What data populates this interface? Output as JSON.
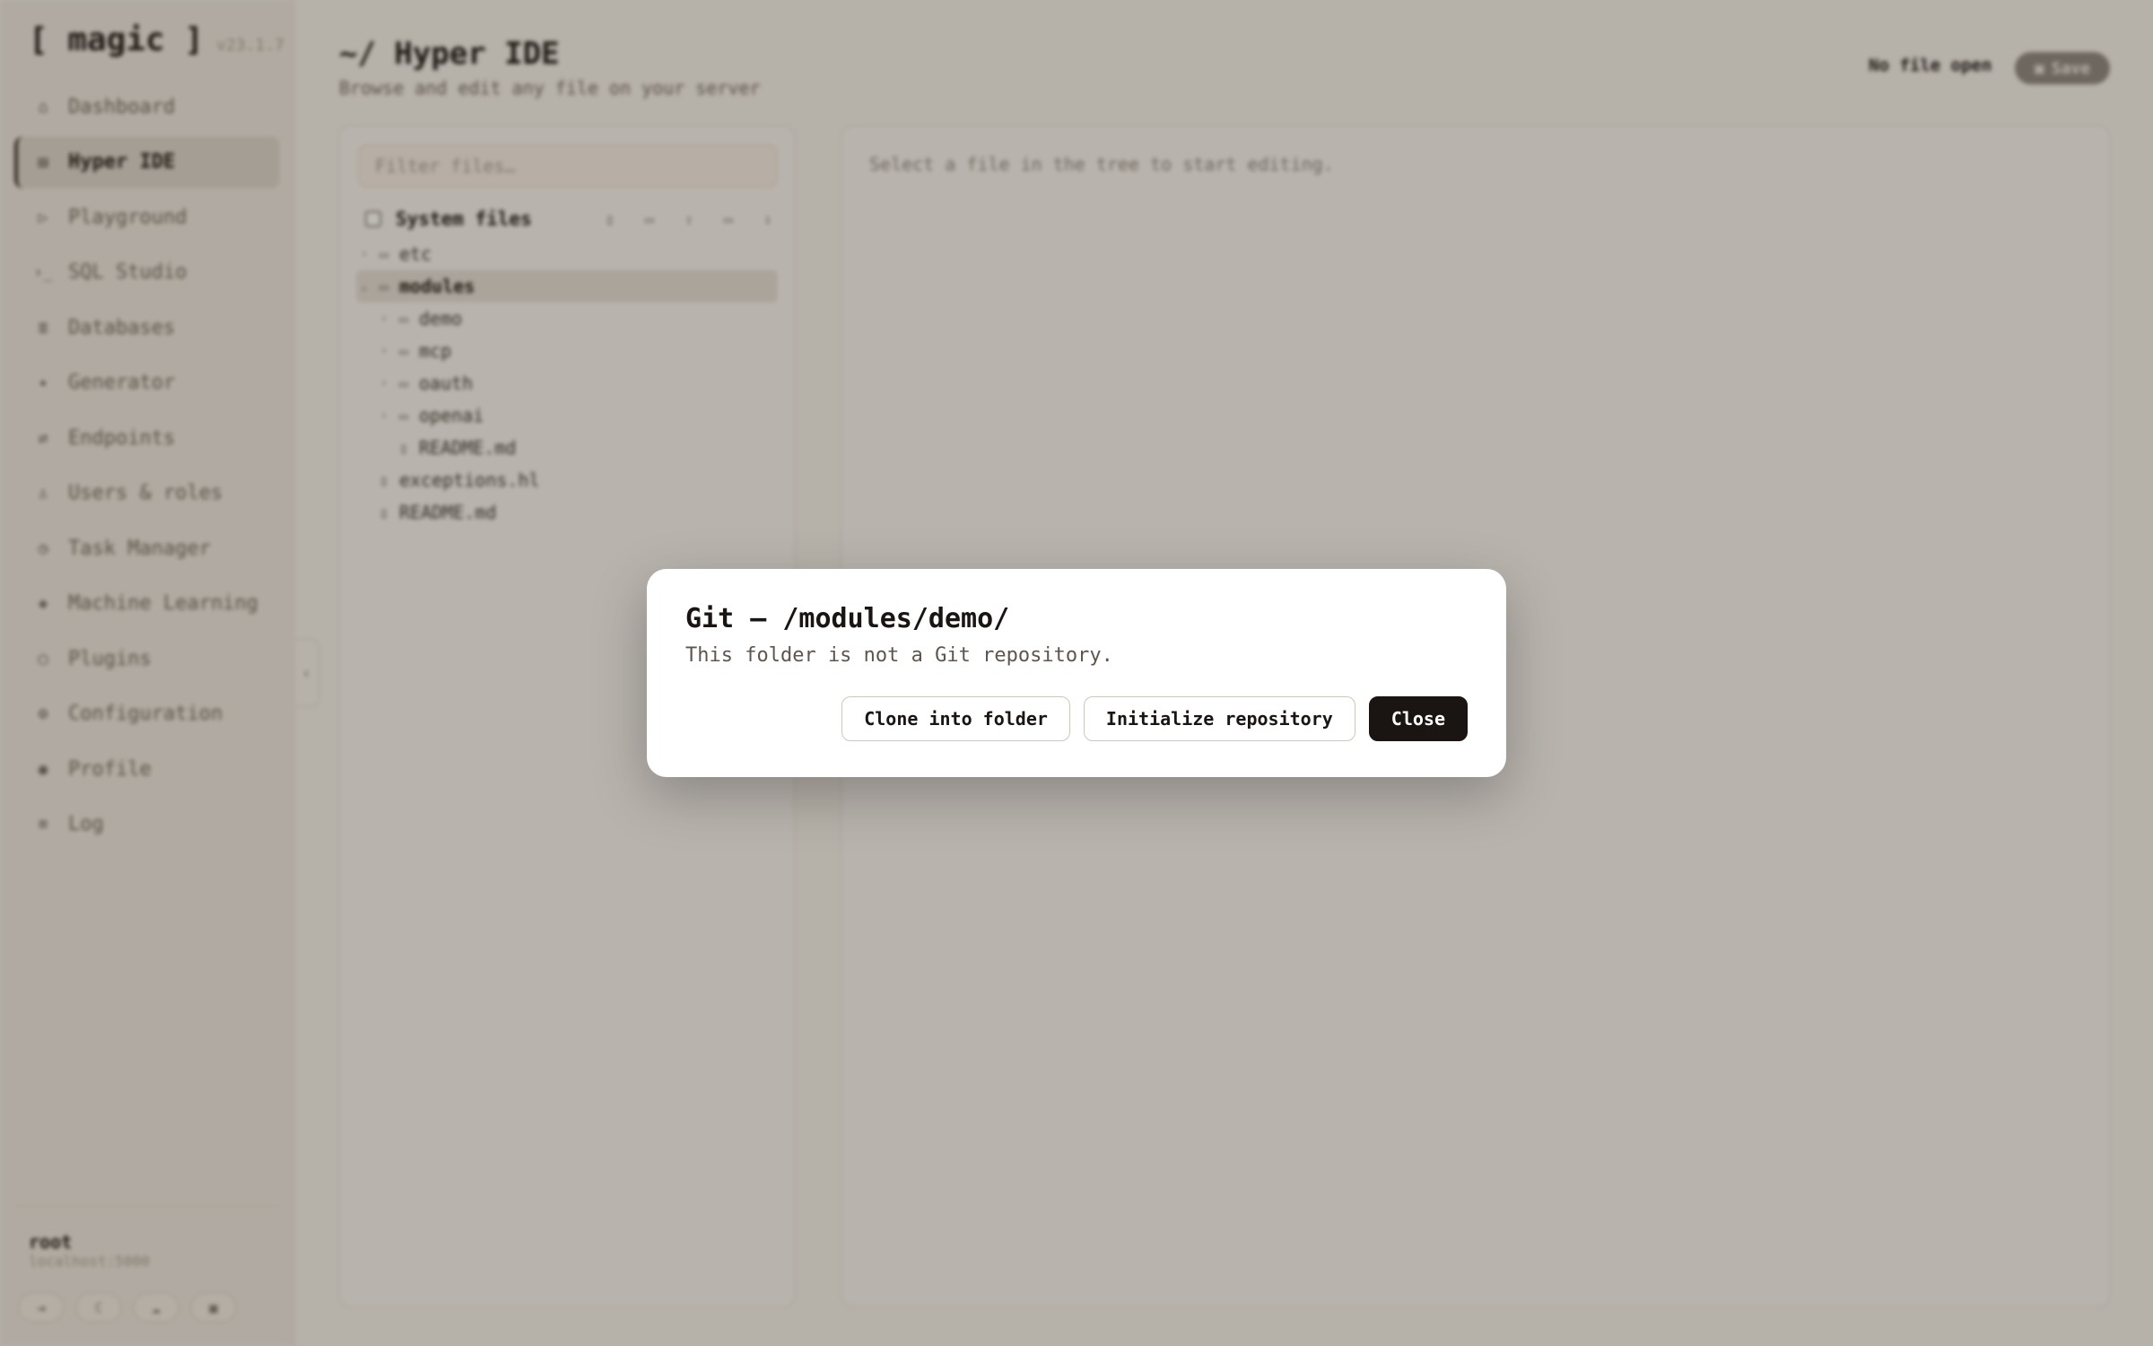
{
  "brand": {
    "logo": "[ magic ]",
    "version": "v23.1.7"
  },
  "sidebar": {
    "items": [
      {
        "label": "Dashboard",
        "icon": "home-icon"
      },
      {
        "label": "Hyper IDE",
        "icon": "file-icon",
        "active": true
      },
      {
        "label": "Playground",
        "icon": "play-icon"
      },
      {
        "label": "SQL Studio",
        "icon": "terminal-icon"
      },
      {
        "label": "Databases",
        "icon": "database-icon"
      },
      {
        "label": "Generator",
        "icon": "sparkle-icon"
      },
      {
        "label": "Endpoints",
        "icon": "arrows-icon"
      },
      {
        "label": "Users & roles",
        "icon": "user-icon"
      },
      {
        "label": "Task Manager",
        "icon": "clock-icon"
      },
      {
        "label": "Machine Learning",
        "icon": "diamond-icon"
      },
      {
        "label": "Plugins",
        "icon": "plugin-icon"
      },
      {
        "label": "Configuration",
        "icon": "gear-icon"
      },
      {
        "label": "Profile",
        "icon": "profile-icon"
      },
      {
        "label": "Log",
        "icon": "list-icon"
      }
    ],
    "user": {
      "name": "root",
      "host": "localhost:5000"
    }
  },
  "header": {
    "title": "~/ Hyper IDE",
    "subtitle": "Browse and edit any file on your server",
    "file_status": "No file open",
    "save_label": "Save"
  },
  "tree": {
    "filter_placeholder": "Filter files…",
    "system_files_label": "System files",
    "rows": [
      {
        "name": "etc",
        "type": "folder",
        "depth": 0
      },
      {
        "name": "modules",
        "type": "folder",
        "depth": 0,
        "expanded": true,
        "selected": true
      },
      {
        "name": "demo",
        "type": "folder",
        "depth": 1
      },
      {
        "name": "mcp",
        "type": "folder",
        "depth": 1
      },
      {
        "name": "oauth",
        "type": "folder",
        "depth": 1
      },
      {
        "name": "openai",
        "type": "folder",
        "depth": 1
      },
      {
        "name": "README.md",
        "type": "file",
        "depth": 1
      },
      {
        "name": "exceptions.hl",
        "type": "file",
        "depth": 0
      },
      {
        "name": "README.md",
        "type": "file",
        "depth": 0
      }
    ]
  },
  "editor": {
    "hint": "Select a file in the tree to start editing."
  },
  "dialog": {
    "title": "Git — /modules/demo/",
    "message": "This folder is not a Git repository.",
    "clone_label": "Clone into folder",
    "init_label": "Initialize repository",
    "close_label": "Close"
  }
}
